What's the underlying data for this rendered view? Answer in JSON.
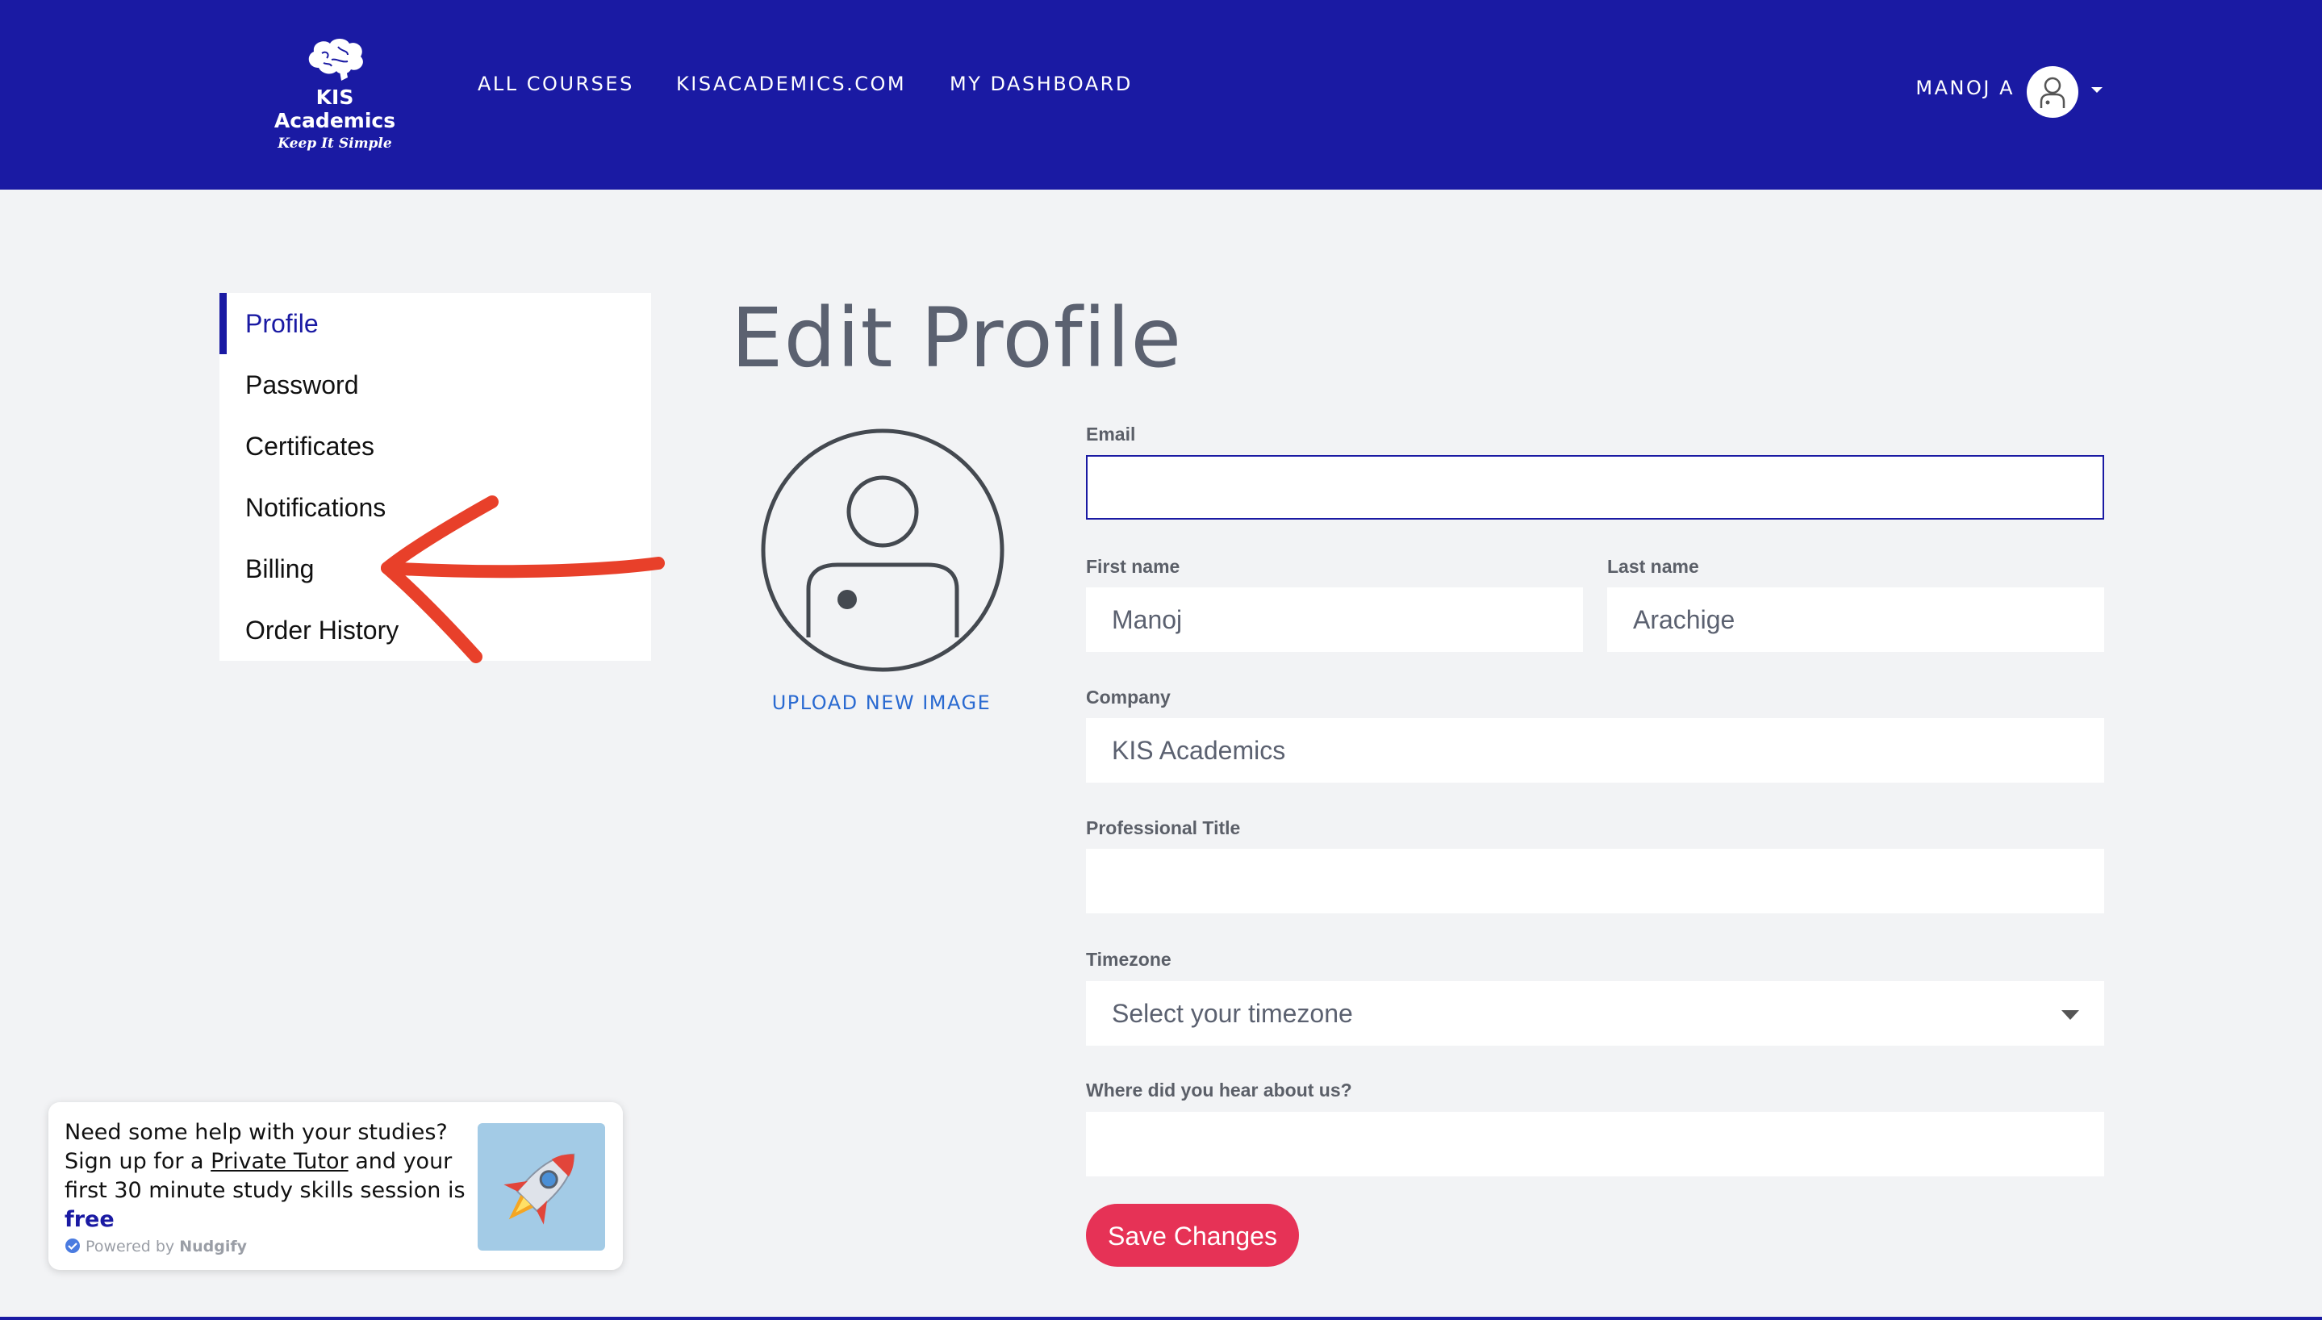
{
  "header": {
    "logo": {
      "name": "KIS Academics",
      "tagline": "Keep It Simple"
    },
    "nav": [
      {
        "label": "ALL COURSES"
      },
      {
        "label": "KISACADEMICS.COM"
      },
      {
        "label": "MY DASHBOARD"
      }
    ],
    "user": {
      "name": "MANOJ A"
    }
  },
  "sidebar": {
    "items": [
      {
        "label": "Profile",
        "active": true
      },
      {
        "label": "Password"
      },
      {
        "label": "Certificates"
      },
      {
        "label": "Notifications"
      },
      {
        "label": "Billing"
      },
      {
        "label": "Order History"
      }
    ]
  },
  "main": {
    "title": "Edit Profile",
    "upload_label": "UPLOAD NEW IMAGE",
    "fields": {
      "email": {
        "label": "Email",
        "value": ""
      },
      "first_name": {
        "label": "First name",
        "value": "Manoj"
      },
      "last_name": {
        "label": "Last name",
        "value": "Arachige"
      },
      "company": {
        "label": "Company",
        "value": "KIS Academics"
      },
      "professional_title": {
        "label": "Professional Title",
        "value": ""
      },
      "timezone": {
        "label": "Timezone",
        "selected": "Select your timezone"
      },
      "referral": {
        "label": "Where did you hear about us?",
        "value": ""
      }
    },
    "save_label": "Save Changes"
  },
  "nudge": {
    "line1": "Need some help with your studies?",
    "line2_pre": "Sign up for a",
    "line2_link": "Private Tutor",
    "line2_post": "and your",
    "line3": "first 30 minute study skills session is",
    "line4": "free",
    "powered_by": "Powered by",
    "powered_brand": "Nudgify",
    "image_icon": "rocket-icon"
  },
  "colors": {
    "brand": "#1a1aa3",
    "background": "#f2f3f5",
    "save": "#e63256",
    "link": "#2a6ad1",
    "annotation": "#e8402a"
  }
}
